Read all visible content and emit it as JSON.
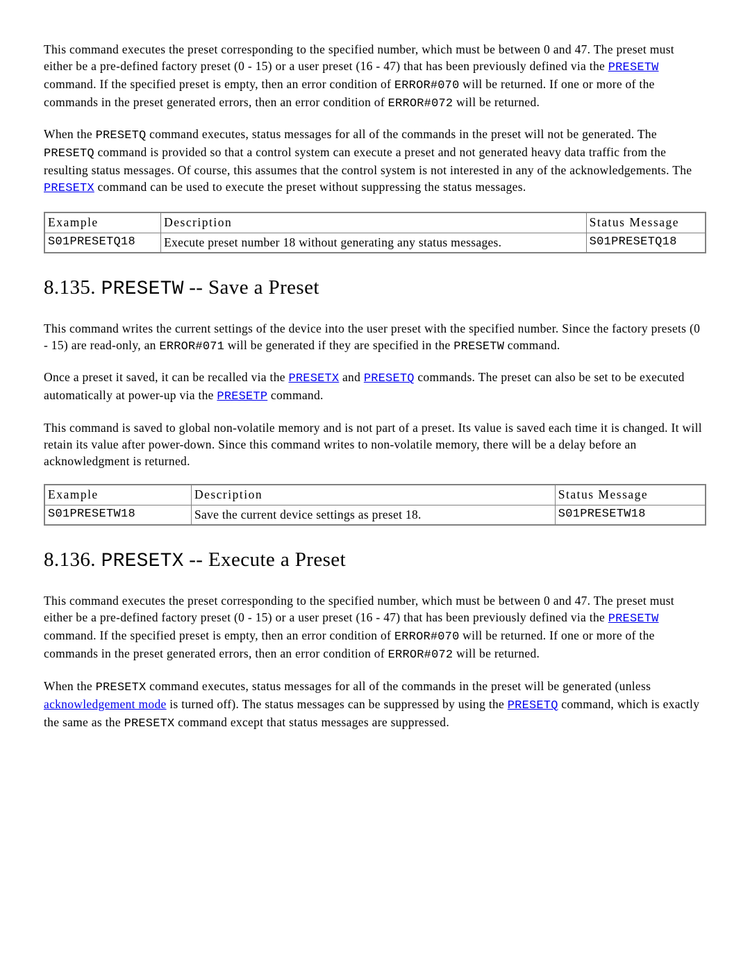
{
  "para1": {
    "t1": "This command executes the preset corresponding to the specified number, which must be between 0 and 47. The preset must either be a pre-defined factory preset (0 - 15) or a user preset (16 - 47) that has been previously defined via the ",
    "link1": "PRESETW",
    "t2": " command. If the specified preset is empty, then an error condition of ",
    "c1": "ERROR#070",
    "t3": " will be returned. If one or more of the commands in the preset generated errors, then an error condition of ",
    "c2": "ERROR#072",
    "t4": " will be returned."
  },
  "para2": {
    "t1": "When the ",
    "c1": "PRESETQ",
    "t2": " command executes, status messages for all of the commands in the preset will not be generated. The ",
    "c2": "PRESETQ",
    "t3": " command is provided so that a control system can execute a preset and not generated heavy data traffic from the resulting status messages. Of course, this assumes that the control system is not interested in any of the acknowledgements. The ",
    "link1": "PRESETX",
    "t4": " command can be used to execute the preset without suppressing the status messages."
  },
  "table1": {
    "h1": "Example",
    "h2": "Description",
    "h3": "Status Message",
    "r1c1": "S01PRESETQ18",
    "r1c2": "Execute preset number 18 without generating any status messages.",
    "r1c3": "S01PRESETQ18"
  },
  "heading1": {
    "num": "8.135. ",
    "code": "PRESETW",
    "rest": " -- Save a Preset"
  },
  "para3": {
    "t1": "This command writes the current settings of the device into the user preset with the specified number. Since the factory presets (0 - 15) are read-only, an ",
    "c1": "ERROR#071",
    "t2": " will be generated if they are specified in the ",
    "c2": "PRESETW",
    "t3": " command."
  },
  "para4": {
    "t1": "Once a preset it saved, it can be recalled via the ",
    "link1": "PRESETX",
    "t2": " and ",
    "link2": "PRESETQ",
    "t3": " commands. The preset can also be set to be executed automatically at power-up via the ",
    "link3": "PRESETP",
    "t4": " command."
  },
  "para5": "This command is saved to global non-volatile memory and is not part of a preset. Its value is saved each time it is changed. It will retain its value after power-down. Since this command writes to non-volatile memory, there will be a delay before an acknowledgment is returned.",
  "table2": {
    "h1": "Example",
    "h2": "Description",
    "h3": "Status Message",
    "r1c1": "S01PRESETW18",
    "r1c2": "Save the current device settings as preset 18.",
    "r1c3": "S01PRESETW18"
  },
  "heading2": {
    "num": "8.136. ",
    "code": "PRESETX",
    "rest": " -- Execute a Preset"
  },
  "para6": {
    "t1": "This command executes the preset corresponding to the specified number, which must be between 0 and 47. The preset must either be a pre-defined factory preset (0 - 15) or a user preset (16 - 47) that has been previously defined via the ",
    "link1": "PRESETW",
    "t2": " command. If the specified preset is empty, then an error condition of ",
    "c1": "ERROR#070",
    "t3": " will be returned. If one or more of the commands in the preset generated errors, then an error condition of ",
    "c2": "ERROR#072",
    "t4": " will be returned."
  },
  "para7": {
    "t1": "When the ",
    "c1": "PRESETX",
    "t2": " command executes, status messages for all of the commands in the preset will be generated (unless ",
    "link1": "acknowledgement mode",
    "t3": " is turned off). The status messages can be suppressed by using the ",
    "link2": "PRESETQ",
    "t4": " command, which is exactly the same as the ",
    "c2": "PRESETX",
    "t5": " command except that status messages are suppressed."
  }
}
